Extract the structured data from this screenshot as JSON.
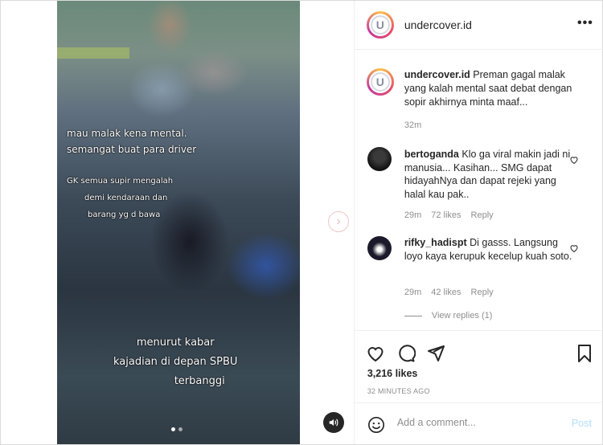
{
  "account": {
    "username": "undercover.id",
    "avatar_letter": "U"
  },
  "video": {
    "overlay_line1": "mau malak kena mental.",
    "overlay_line2": "semangat buat para driver",
    "overlay_line3": "GK semua supir mengalah",
    "overlay_line4": "demi kendaraan dan",
    "overlay_line5": "barang yg d bawa",
    "overlay_line6": "menurut kabar",
    "overlay_line7": "kajadian di depan SPBU",
    "overlay_line8": "terbanggi",
    "carousel_pages": 2,
    "carousel_active": 1
  },
  "caption": {
    "username": "undercover.id",
    "text": " Preman gagal malak yang kalah mental saat debat dengan sopir akhirnya minta maaf...",
    "time": "32m"
  },
  "comments": [
    {
      "username": "bertoganda",
      "text": " Klo ga viral makin jadi ni manusia... Kasihan... SMG dapat hidayahNya dan dapat rejeki yang halal kau pak..",
      "time": "29m",
      "likes": "72 likes",
      "reply": "Reply"
    },
    {
      "username": "rifky_hadispt",
      "text": " Di gasss. Langsung loyo kaya kerupuk kecelup kuah soto.",
      "time": "29m",
      "likes": "42 likes",
      "reply": "Reply",
      "view_replies": "View replies (1)"
    }
  ],
  "stats": {
    "likes": "3,216 likes",
    "posted": "32 MINUTES AGO"
  },
  "add_comment": {
    "placeholder": "Add a comment...",
    "post_label": "Post"
  },
  "more_label": "•••",
  "colors": {
    "post_button": "#b2dffc",
    "muted_text": "#8e8e8e",
    "text": "#262626"
  }
}
